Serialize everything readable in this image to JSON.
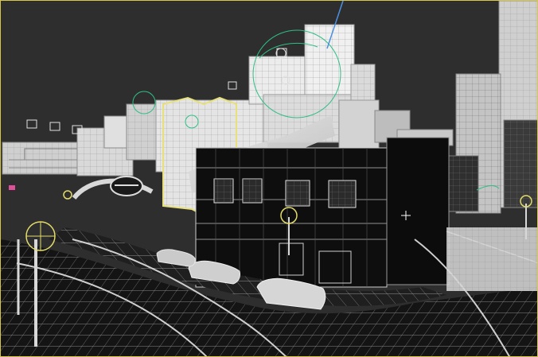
{
  "viewport": {
    "mode": "wireframe-shaded",
    "active_border_color": "#d6c64a",
    "background_color": "#2e2e2e",
    "selection_color": "#e8e07a",
    "helper_color": "#2fbf86"
  },
  "scene": {
    "signage": {
      "logo_icon": "arch-sign-icon"
    },
    "icons": {
      "camera": "camera-icon",
      "light": "light-bulb-icon",
      "streetlamp": "street-lamp-icon",
      "gizmo": "transform-gizmo-icon"
    }
  }
}
